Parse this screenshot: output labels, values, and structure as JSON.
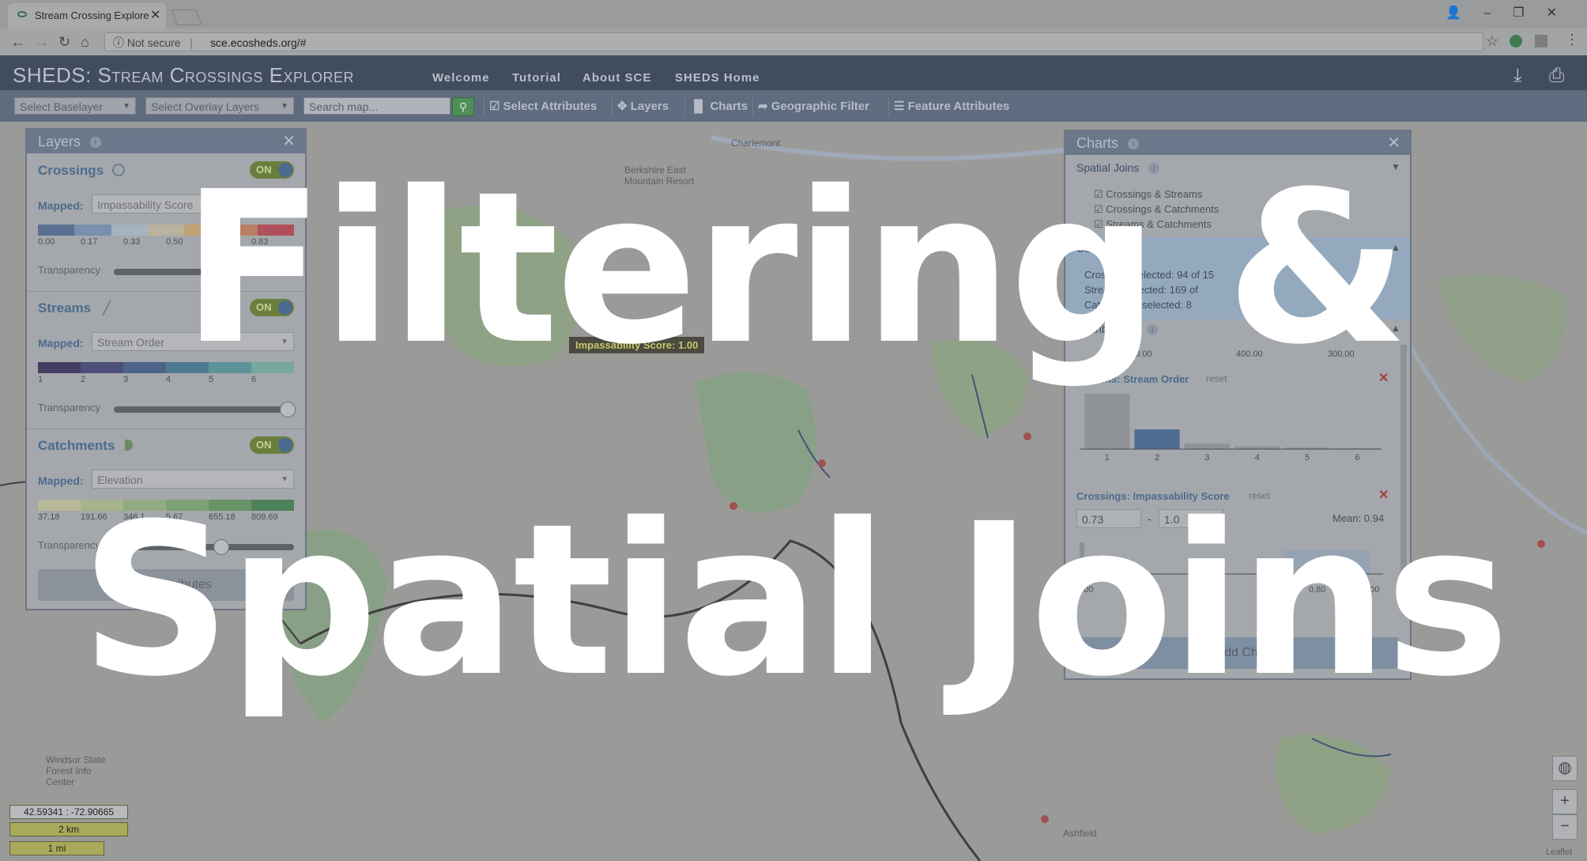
{
  "browser": {
    "tab_title": "Stream Crossing Explore",
    "url_warning": "Not secure",
    "url": "sce.ecosheds.org/#",
    "window_controls": [
      "👤",
      "–",
      "❐",
      "✕"
    ]
  },
  "app": {
    "title": "SHEDS: Stream Crossings Explorer",
    "nav": [
      "Welcome",
      "Tutorial",
      "About SCE",
      "SHEDS Home"
    ]
  },
  "toolbar": {
    "baselayer_placeholder": "Select Baselayer",
    "overlay_placeholder": "Select Overlay Layers",
    "search_placeholder": "Search map...",
    "buttons": [
      "Select Attributes",
      "Layers",
      "Charts",
      "Geographic Filter",
      "Feature Attributes"
    ]
  },
  "layers_panel": {
    "title": "Layers",
    "crossings": {
      "name": "Crossings",
      "toggle": "ON",
      "mapped_label": "Mapped:",
      "mapped_value": "Impassability Score",
      "ticks": [
        "0.00",
        "0.17",
        "0.33",
        "0.50",
        "0.",
        "0.83"
      ],
      "transparency_label": "Transparency",
      "transparency": 0.55,
      "colors": [
        "#5b6f93",
        "#7890ad",
        "#a6b3c1",
        "#b9b29d",
        "#c2a274",
        "#b97f62",
        "#b0505a"
      ]
    },
    "streams": {
      "name": "Streams",
      "toggle": "ON",
      "mapped_label": "Mapped:",
      "mapped_value": "Stream Order",
      "ticks": [
        "1",
        "2",
        "3",
        "4",
        "5",
        "6"
      ],
      "transparency_label": "Transparency",
      "transparency": 1.0,
      "colors": [
        "#443f62",
        "#4c4f7a",
        "#4d6388",
        "#4e7b92",
        "#5c9398",
        "#78a79b"
      ]
    },
    "catchments": {
      "name": "Catchments",
      "toggle": "ON",
      "mapped_label": "Mapped:",
      "mapped_value": "Elevation",
      "ticks": [
        "37.18",
        "191.66",
        "346.1",
        "5.67",
        "655.18",
        "809.69"
      ],
      "transparency_label": "Transparency",
      "transparency": 0.6,
      "colors": [
        "#b7b998",
        "#a6b48b",
        "#92ab80",
        "#7d9f74",
        "#679367",
        "#4e825a"
      ]
    },
    "footer_button": "Select Attributes"
  },
  "charts_panel": {
    "title": "Charts",
    "spatial_joins_label": "Spatial Joins",
    "joins": [
      "Crossings & Streams",
      "Crossings & Catchments",
      "Streams & Catchments"
    ],
    "counts_label": "Counts",
    "counts": [
      "Crossings selected: 94 of 15",
      "Streams selected: 169 of",
      "Catchments selected: 8"
    ],
    "distributions_label": "Distributions",
    "top_axis_ticks": [
      "200.00",
      "400.00",
      "300.00"
    ],
    "stream_order_chart": {
      "title": "Streams: Stream Order",
      "reset": "reset",
      "categories": [
        "1",
        "2",
        "3",
        "4",
        "5",
        "6"
      ],
      "values": [
        62,
        22,
        6,
        3,
        2,
        1
      ]
    },
    "impassability_chart": {
      "title": "Crossings: Impassability Score",
      "reset": "reset",
      "min_value": "0.73",
      "range_dash": "-",
      "max_value": "1.0",
      "mean_label": "Mean: 0.94",
      "ticks": [
        "0.00",
        "0.80",
        "1.00"
      ]
    },
    "add_chart_button": "Add Chart"
  },
  "map": {
    "tooltip": "Impassability Score: 1.00",
    "coords": "42.59341 : -72.90665",
    "scale_km": "2 km",
    "scale_mi": "1 mi",
    "labels": [
      "Berkshire East Mountain Resort",
      "Charlemont",
      "Windsor State Forest Info Center",
      "Ashfield",
      "Leaflet"
    ],
    "zoom_in": "+",
    "zoom_out": "−"
  },
  "overlay": {
    "line1": "Filtering &",
    "line2": "Spatial Joins"
  }
}
